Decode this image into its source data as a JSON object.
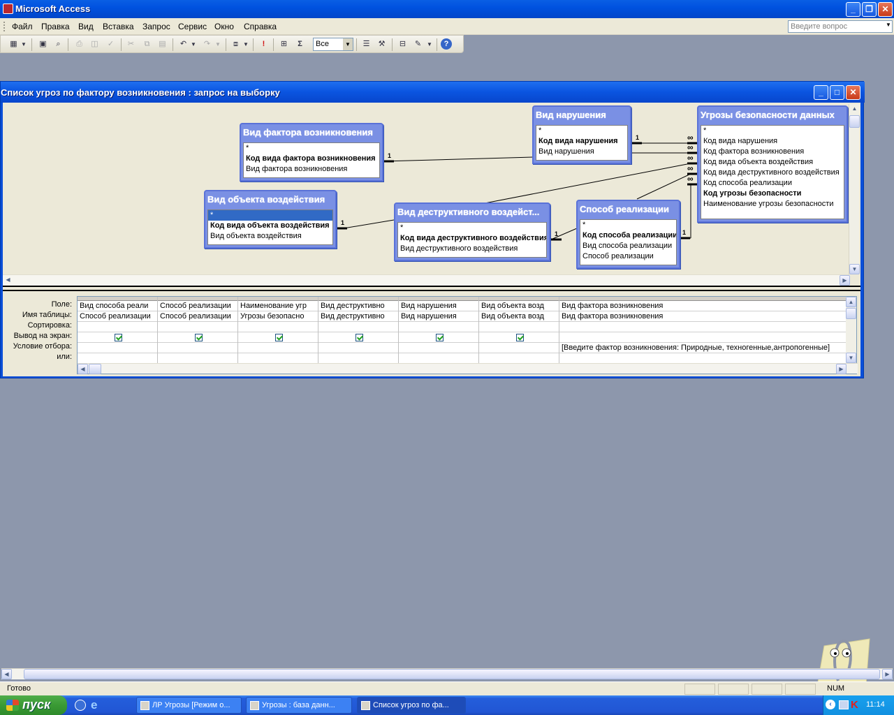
{
  "app": {
    "title": "Microsoft Access"
  },
  "menu": [
    "Файл",
    "Правка",
    "Вид",
    "Вставка",
    "Запрос",
    "Сервис",
    "Окно",
    "Справка"
  ],
  "help_placeholder": "Введите вопрос",
  "toolbar": {
    "combo_value": "Все"
  },
  "query_window": {
    "title": "Список угроз по фактору возникновения : запрос на выборку"
  },
  "tables": {
    "factor": {
      "name": "Вид фактора возникновения",
      "fields": [
        "*",
        "Код вида фактора возникновения",
        "Вид фактора возникновения"
      ]
    },
    "object": {
      "name": "Вид объекта воздействия",
      "fields": [
        "*",
        "Код вида объекта воздействия",
        "Вид объекта воздействия"
      ]
    },
    "destr": {
      "name": "Вид деструктивного воздейст...",
      "fields": [
        "*",
        "Код вида деструктивного воздействия",
        "Вид деструктивного воздействия"
      ]
    },
    "violation": {
      "name": "Вид нарушения",
      "fields": [
        "*",
        "Код вида нарушения",
        "Вид нарушения"
      ]
    },
    "method": {
      "name": "Способ реализации",
      "fields": [
        "*",
        "Код способа реализации",
        "Вид способа реализации",
        "Способ реализации"
      ]
    },
    "threats": {
      "name": "Угрозы безопасности данных",
      "fields": [
        "*",
        "Код вида нарушения",
        "Код фактора возникновения",
        "Код вида объекта воздействия",
        "Код вида деструктивного воздействия",
        "Код способа реализации",
        "Код угрозы безопасности",
        "Наименование угрозы безопасности"
      ]
    }
  },
  "relation_labels": {
    "one": "1",
    "many": "∞"
  },
  "grid": {
    "row_labels": [
      "Поле:",
      "Имя таблицы:",
      "Сортировка:",
      "Вывод на экран:",
      "Условие отбора:",
      "или:"
    ],
    "columns": [
      {
        "field": "Вид способа реали",
        "table": "Способ реализации",
        "show": true,
        "criteria": ""
      },
      {
        "field": "Способ реализации",
        "table": "Способ реализации",
        "show": true,
        "criteria": ""
      },
      {
        "field": "Наименование угр",
        "table": "Угрозы безопасно",
        "show": true,
        "criteria": ""
      },
      {
        "field": "Вид деструктивно",
        "table": "Вид деструктивно",
        "show": true,
        "criteria": ""
      },
      {
        "field": "Вид нарушения",
        "table": "Вид нарушения",
        "show": true,
        "criteria": ""
      },
      {
        "field": "Вид объекта возд",
        "table": "Вид объекта возд",
        "show": true,
        "criteria": ""
      },
      {
        "field": "Вид фактора возникновения",
        "table": "Вид фактора возникновения",
        "show": false,
        "criteria": "[Введите фактор возникновения: Природные, техногенные,антропогенные]"
      }
    ]
  },
  "status": {
    "text": "Готово",
    "mode": "NUM"
  },
  "taskbar": {
    "start": "пуск",
    "tasks": [
      "ЛР Угрозы [Режим о...",
      "Угрозы : база данн...",
      "Список угроз по фа..."
    ],
    "clock": "11:14"
  }
}
